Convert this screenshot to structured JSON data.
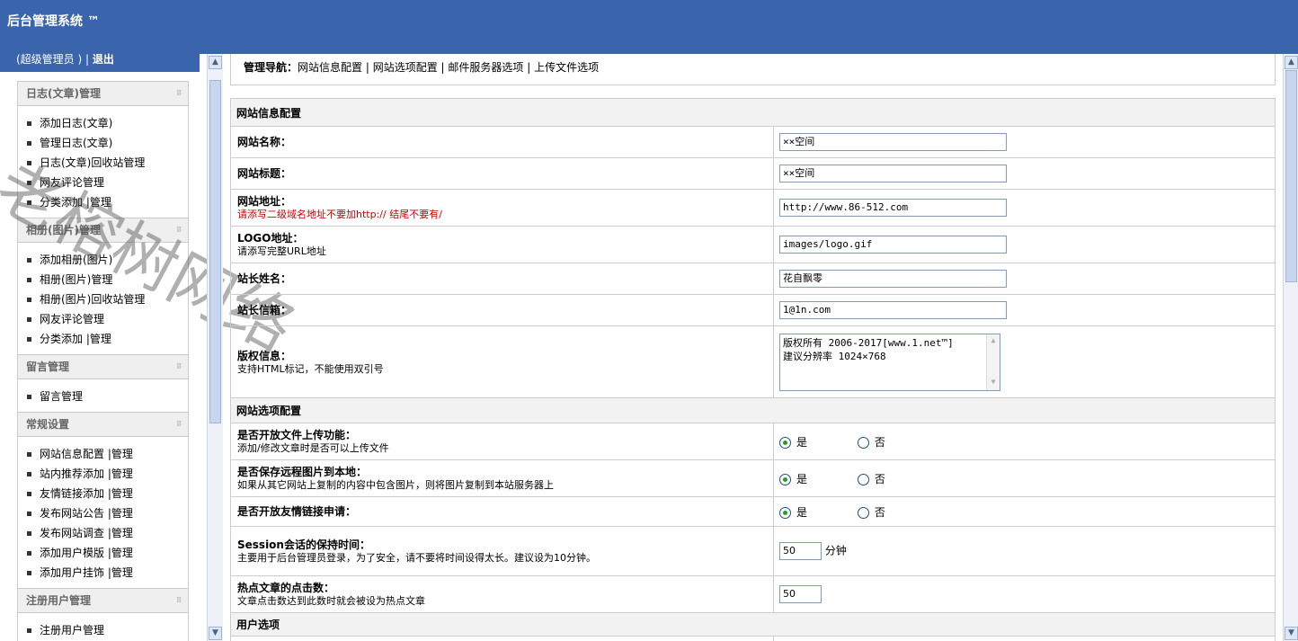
{
  "app": {
    "title": "后台管理系统 ™"
  },
  "user": {
    "role": "(超级管理员 )",
    "separator": " | ",
    "logout": "退出"
  },
  "watermark": "老榕树网络",
  "sidebar": {
    "groups": [
      {
        "title": "日志(文章)管理",
        "items": [
          "添加日志(文章)",
          "管理日志(文章)",
          "日志(文章)回收站管理",
          "网友评论管理",
          "分类添加 |管理"
        ]
      },
      {
        "title": "相册(图片)管理",
        "items": [
          "添加相册(图片)",
          "相册(图片)管理",
          "相册(图片)回收站管理",
          "网友评论管理",
          "分类添加 |管理"
        ]
      },
      {
        "title": "留言管理",
        "items": [
          "留言管理"
        ]
      },
      {
        "title": "常规设置",
        "items": [
          "网站信息配置 |管理",
          "站内推荐添加 |管理",
          "友情链接添加 |管理",
          "发布网站公告 |管理",
          "发布网站调查 |管理",
          "添加用户模版 |管理",
          "添加用户挂饰 |管理"
        ]
      },
      {
        "title": "注册用户管理",
        "items": [
          "注册用户管理"
        ]
      }
    ]
  },
  "nav": {
    "label": "管理导航：",
    "links": [
      "网站信息配置",
      "网站选项配置",
      "邮件服务器选项",
      "上传文件选项"
    ],
    "sep": " | "
  },
  "form": {
    "section1": "网站信息配置",
    "site_name": {
      "label": "网站名称：",
      "value": "××空间"
    },
    "site_title": {
      "label": "网站标题：",
      "value": "××空间"
    },
    "site_url": {
      "label": "网站地址：",
      "hint": "请添写二级域名地址不要加http:// 结尾不要有/",
      "value": "http://www.86-512.com"
    },
    "logo": {
      "label": "LOGO地址：",
      "hint": "请添写完整URL地址",
      "value": "images/logo.gif"
    },
    "owner_name": {
      "label": "站长姓名：",
      "value": "花自飘零"
    },
    "owner_email": {
      "label": "站长信箱：",
      "value": "1@1n.com"
    },
    "copyright": {
      "label": "版权信息：",
      "hint": "支持HTML标记，不能使用双引号",
      "line1": "版权所有 2006-2017[www.1.net™]",
      "line2": "建议分辨率 1024×768"
    },
    "section2": "网站选项配置",
    "upload": {
      "label": "是否开放文件上传功能：",
      "hint": "添加/修改文章时是否可以上传文件"
    },
    "remote_img": {
      "label": "是否保存远程图片到本地：",
      "hint": "如果从其它网站上复制的内容中包含图片，则将图片复制到本站服务器上"
    },
    "friend_link": {
      "label": "是否开放友情链接申请："
    },
    "session": {
      "label": "Session会话的保持时间：",
      "hint": "主要用于后台管理员登录，为了安全，请不要将时间设得太长。建议设为10分钟。",
      "value": "50",
      "unit": "分钟"
    },
    "hot": {
      "label": "热点文章的点击数：",
      "hint": "文章点击数达到此数时就会被设为热点文章",
      "value": "50"
    },
    "section3": "用户选项",
    "yes": "是",
    "no": "否"
  }
}
